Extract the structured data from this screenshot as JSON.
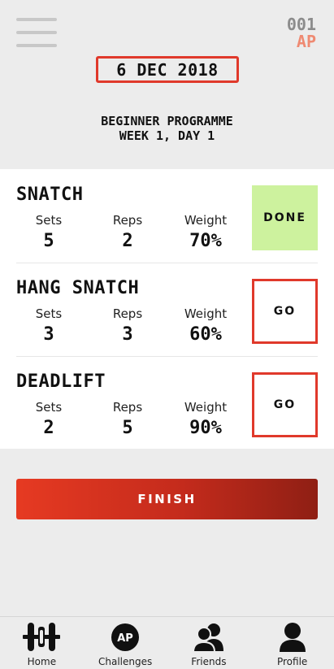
{
  "header": {
    "menu_icon": "hamburger-menu-icon",
    "logo_number": "001",
    "logo_letters": "AP",
    "date": "6 DEC 2018"
  },
  "programme": {
    "line1": "BEGINNER PROGRAMME",
    "line2": "WEEK 1, DAY 1"
  },
  "stat_labels": {
    "sets": "Sets",
    "reps": "Reps",
    "weight": "Weight"
  },
  "exercises": [
    {
      "name": "SNATCH",
      "sets": "5",
      "reps": "2",
      "weight": "70%",
      "action": "DONE",
      "state": "done"
    },
    {
      "name": "HANG SNATCH",
      "sets": "3",
      "reps": "3",
      "weight": "60%",
      "action": "GO",
      "state": "go"
    },
    {
      "name": "DEADLIFT",
      "sets": "2",
      "reps": "5",
      "weight": "90%",
      "action": "GO",
      "state": "go"
    }
  ],
  "finish_label": "FINISH",
  "nav": [
    {
      "label": "Home",
      "icon": "barbell-icon"
    },
    {
      "label": "Challenges",
      "icon": "ap-badge-icon"
    },
    {
      "label": "Friends",
      "icon": "friends-icon"
    },
    {
      "label": "Profile",
      "icon": "profile-icon"
    }
  ],
  "colors": {
    "accent_red": "#e0392b",
    "done_green": "#cdf29e",
    "logo_orange": "#ef8a72",
    "background": "#ececec"
  }
}
